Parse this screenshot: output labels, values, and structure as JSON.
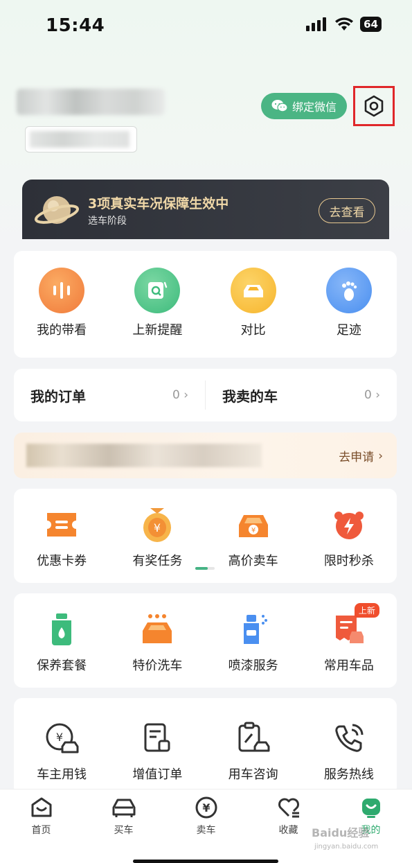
{
  "status_bar": {
    "time": "15:44",
    "battery": "64"
  },
  "profile": {
    "bind_wechat_label": "绑定微信"
  },
  "banner": {
    "title": "3项真实车况保障生效中",
    "subtitle": "选车阶段",
    "button": "去查看"
  },
  "quick_actions": [
    {
      "label": "我的带看",
      "icon": "sound-wave-icon",
      "color": "#f07a3a"
    },
    {
      "label": "上新提醒",
      "icon": "new-alert-icon",
      "color": "#3dbb7c"
    },
    {
      "label": "对比",
      "icon": "compare-car-icon",
      "color": "#f7b52d"
    },
    {
      "label": "足迹",
      "icon": "footprint-icon",
      "color": "#4a8ff0"
    }
  ],
  "orders": {
    "my_orders": {
      "label": "我的订单",
      "count": "0"
    },
    "sold_cars": {
      "label": "我卖的车",
      "count": "0"
    }
  },
  "loan_banner": {
    "action": "去申请"
  },
  "services_row1": [
    {
      "label": "优惠卡券",
      "icon": "coupon-icon"
    },
    {
      "label": "有奖任务",
      "icon": "reward-coin-icon"
    },
    {
      "label": "高价卖车",
      "icon": "sell-car-icon"
    },
    {
      "label": "限时秒杀",
      "icon": "flash-sale-icon"
    }
  ],
  "services_row2": [
    {
      "label": "保养套餐",
      "icon": "maintenance-bottle-icon"
    },
    {
      "label": "特价洗车",
      "icon": "car-wash-icon"
    },
    {
      "label": "喷漆服务",
      "icon": "spray-paint-icon"
    },
    {
      "label": "常用车品",
      "icon": "car-products-icon",
      "badge": "上新"
    }
  ],
  "services_row3": [
    {
      "label": "车主用钱",
      "icon": "owner-loan-icon"
    },
    {
      "label": "增值订单",
      "icon": "value-order-icon"
    },
    {
      "label": "用车咨询",
      "icon": "consult-icon"
    },
    {
      "label": "服务热线",
      "icon": "hotline-phone-icon"
    }
  ],
  "tabbar": [
    {
      "label": "首页",
      "icon": "home-icon"
    },
    {
      "label": "买车",
      "icon": "buy-car-icon"
    },
    {
      "label": "卖车",
      "icon": "sell-yen-icon"
    },
    {
      "label": "收藏",
      "icon": "favorite-icon"
    },
    {
      "label": "我的",
      "icon": "profile-icon",
      "active": true
    }
  ],
  "watermark": {
    "text": "Baidu经验",
    "sub": "jingyan.baidu.com"
  }
}
